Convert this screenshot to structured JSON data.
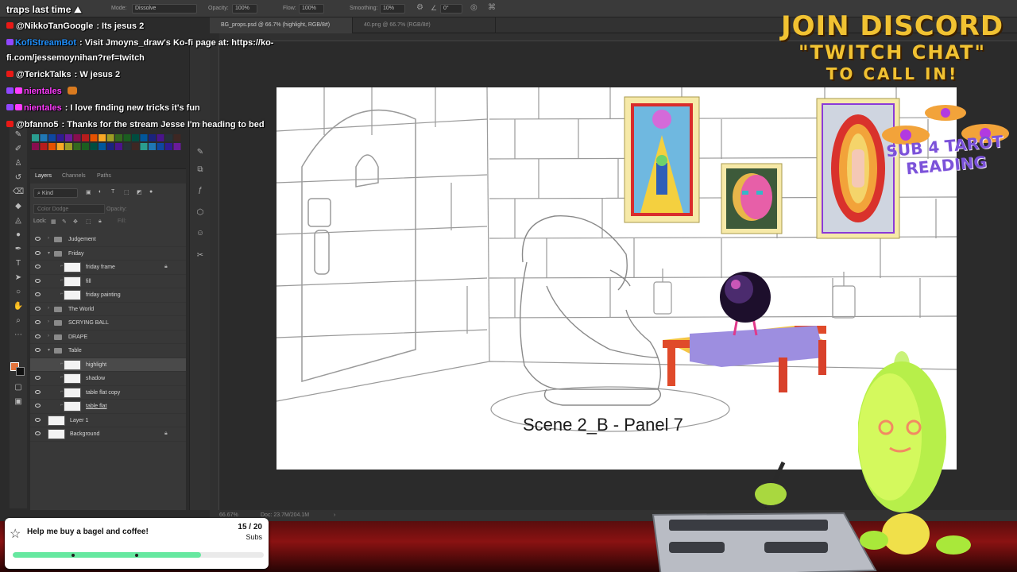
{
  "chat": {
    "header": "traps last time",
    "messages": [
      {
        "user": "@NikkoTanGoogle",
        "text": ": Its jesus 2",
        "user_color": "#ffffff"
      },
      {
        "user": "KofiStreamBot",
        "text": ": Visit Jmoyns_draw's Ko-fi page at: https://ko-",
        "user_color": "#1e90ff"
      },
      {
        "user": "",
        "text": "fi.com/jessemoynihan?ref=twitch",
        "user_color": "#ffffff"
      },
      {
        "user": "@TerickTalks",
        "text": ": W jesus 2",
        "user_color": "#ffffff"
      },
      {
        "user": "nientales",
        "text": "",
        "user_color": "#ff3bff"
      },
      {
        "user": "nientales",
        "text": ": I love finding new tricks it's fun",
        "user_color": "#ff3bff"
      },
      {
        "user": "@bfanno5",
        "text": ": Thanks for the stream Jesse I'm heading to bed",
        "user_color": "#ffffff"
      }
    ]
  },
  "options_bar": {
    "mode_label": "Mode:",
    "mode_value": "Dissolve",
    "opacity_label": "Opacity:",
    "opacity_value": "100%",
    "flow_label": "Flow:",
    "flow_value": "100%",
    "smoothing_label": "Smoothing:",
    "smoothing_value": "10%",
    "angle_value": "0°"
  },
  "doc_tabs": [
    {
      "label": "BG_props.psd @ 66.7% (highlight, RGB/8#)",
      "active": true
    },
    {
      "label": "40.png @ 66.7% (RGB/8#)",
      "active": false
    }
  ],
  "layers_panel": {
    "tabs": [
      "Layers",
      "Channels",
      "Paths"
    ],
    "filter_kind": "Kind",
    "blend_mode": "Color Dodge",
    "opacity_label": "Opacity:",
    "lock_label": "Lock:",
    "fill_label": "Fill:",
    "layers": [
      {
        "name": "Judgement",
        "type": "group",
        "indent": 0,
        "expanded": false,
        "visible": true,
        "selected": false,
        "locked": false
      },
      {
        "name": "Friday",
        "type": "group",
        "indent": 0,
        "expanded": true,
        "visible": true,
        "selected": false,
        "locked": false
      },
      {
        "name": "friday frame",
        "type": "layer",
        "indent": 1,
        "visible": true,
        "selected": false,
        "locked": true
      },
      {
        "name": "fill",
        "type": "layer",
        "indent": 1,
        "visible": true,
        "selected": false,
        "locked": false
      },
      {
        "name": "friday painting",
        "type": "layer",
        "indent": 1,
        "visible": true,
        "selected": false,
        "locked": false
      },
      {
        "name": "The World",
        "type": "group",
        "indent": 0,
        "expanded": false,
        "visible": true,
        "selected": false,
        "locked": false
      },
      {
        "name": "SCRYING BALL",
        "type": "group",
        "indent": 0,
        "expanded": false,
        "visible": true,
        "selected": false,
        "locked": false
      },
      {
        "name": "DRAPE",
        "type": "group",
        "indent": 0,
        "expanded": false,
        "visible": true,
        "selected": false,
        "locked": false
      },
      {
        "name": "Table",
        "type": "group",
        "indent": 0,
        "expanded": true,
        "visible": true,
        "selected": false,
        "locked": false
      },
      {
        "name": "highlight",
        "type": "layer",
        "indent": 1,
        "visible": false,
        "selected": true,
        "locked": false
      },
      {
        "name": "shadow",
        "type": "layer",
        "indent": 1,
        "visible": true,
        "selected": false,
        "locked": false
      },
      {
        "name": "table flat copy",
        "type": "layer",
        "indent": 1,
        "visible": true,
        "selected": false,
        "locked": false
      },
      {
        "name": "table flat",
        "type": "layer",
        "indent": 1,
        "visible": true,
        "selected": false,
        "locked": false,
        "underline": true
      },
      {
        "name": "Layer 1",
        "type": "layer",
        "indent": 0,
        "visible": true,
        "selected": false,
        "locked": false
      },
      {
        "name": "Background",
        "type": "layer",
        "indent": 0,
        "visible": true,
        "selected": false,
        "locked": true
      }
    ]
  },
  "status_bar": {
    "zoom": "66.67%",
    "doc_size": "Doc: 23.7M/204.1M"
  },
  "canvas": {
    "caption": "Scene 2_B - Panel 7"
  },
  "overlay": {
    "discord_line1": "JOIN DISCORD",
    "discord_line2": "\"TWITCH CHAT\"",
    "discord_line3": "TO CALL IN!",
    "tarot_line1": "SUB 4 TAROT",
    "tarot_line2": "READING"
  },
  "sub_goal": {
    "title": "Help me buy a bagel and coffee!",
    "count": "15 / 20",
    "unit": "Subs",
    "progress": 0.75
  },
  "colors": {
    "accent_yellow": "#f1c232",
    "accent_purple": "#7b52d9",
    "progress_green": "#66e8a0",
    "table_red": "#e04a2a",
    "table_yellow": "#f5c544",
    "drape_purple": "#9d8ee0"
  }
}
